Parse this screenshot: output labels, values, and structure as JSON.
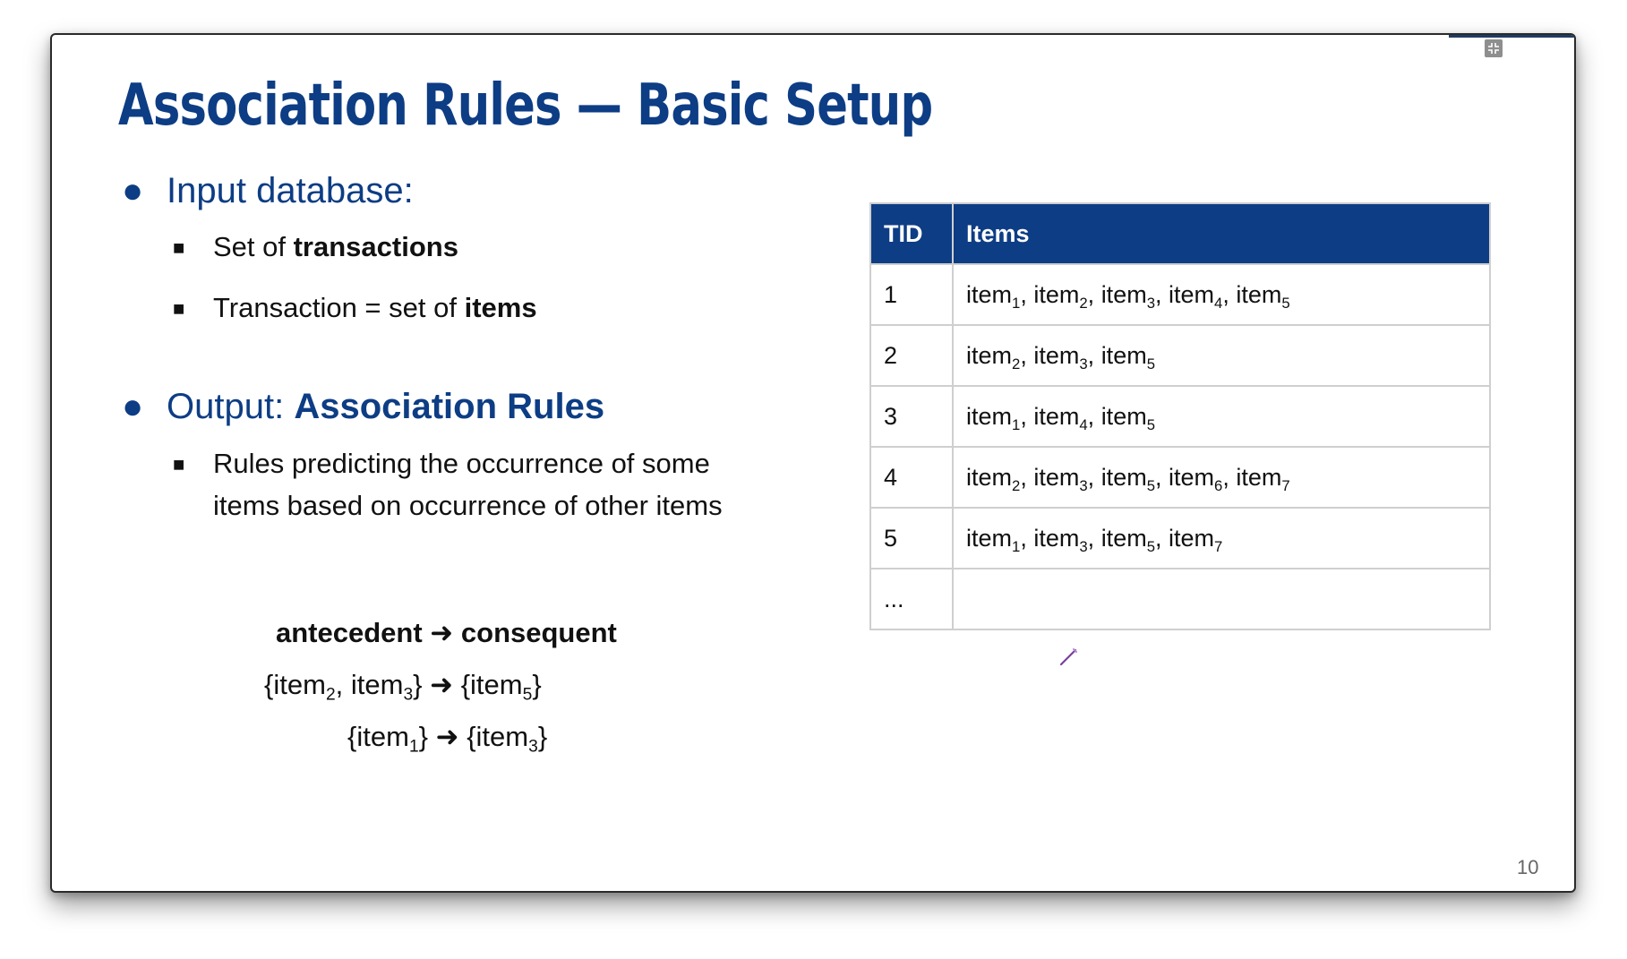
{
  "slide": {
    "title": "Association Rules — Basic Setup",
    "page_number": "10",
    "bullets": {
      "input": {
        "label": "Input database:",
        "sub1_prefix": "Set of ",
        "sub1_bold": "transactions",
        "sub2_prefix": "Transaction = set of ",
        "sub2_bold": "items"
      },
      "output": {
        "label_prefix": "Output: ",
        "label_bold": "Association Rules",
        "sub_line1": "Rules predicting the occurrence of some",
        "sub_line2": "items based on occurrence of other items"
      }
    },
    "rules": {
      "antecedent": "antecedent",
      "arrow": "➜",
      "consequent": "consequent",
      "item_word": "item",
      "rule1": {
        "lhs": [
          "2",
          "3"
        ],
        "rhs": [
          "5"
        ]
      },
      "rule2": {
        "lhs": [
          "1"
        ],
        "rhs": [
          "3"
        ]
      }
    },
    "table": {
      "headers": [
        "TID",
        "Items"
      ],
      "rows": [
        {
          "tid": "1",
          "items": [
            "1",
            "2",
            "3",
            "4",
            "5"
          ]
        },
        {
          "tid": "2",
          "items": [
            "2",
            "3",
            "5"
          ]
        },
        {
          "tid": "3",
          "items": [
            "1",
            "4",
            "5"
          ]
        },
        {
          "tid": "4",
          "items": [
            "2",
            "3",
            "5",
            "6",
            "7"
          ]
        },
        {
          "tid": "5",
          "items": [
            "1",
            "3",
            "5",
            "7"
          ]
        },
        {
          "tid": "...",
          "items": []
        }
      ]
    }
  },
  "icons": {
    "exit_fullscreen": "exit-fullscreen-icon",
    "pen": "pen-icon"
  },
  "colors": {
    "title_blue": "#0d3d84",
    "table_header_bg": "#0d3d84",
    "pen": "#7a3fa0"
  }
}
